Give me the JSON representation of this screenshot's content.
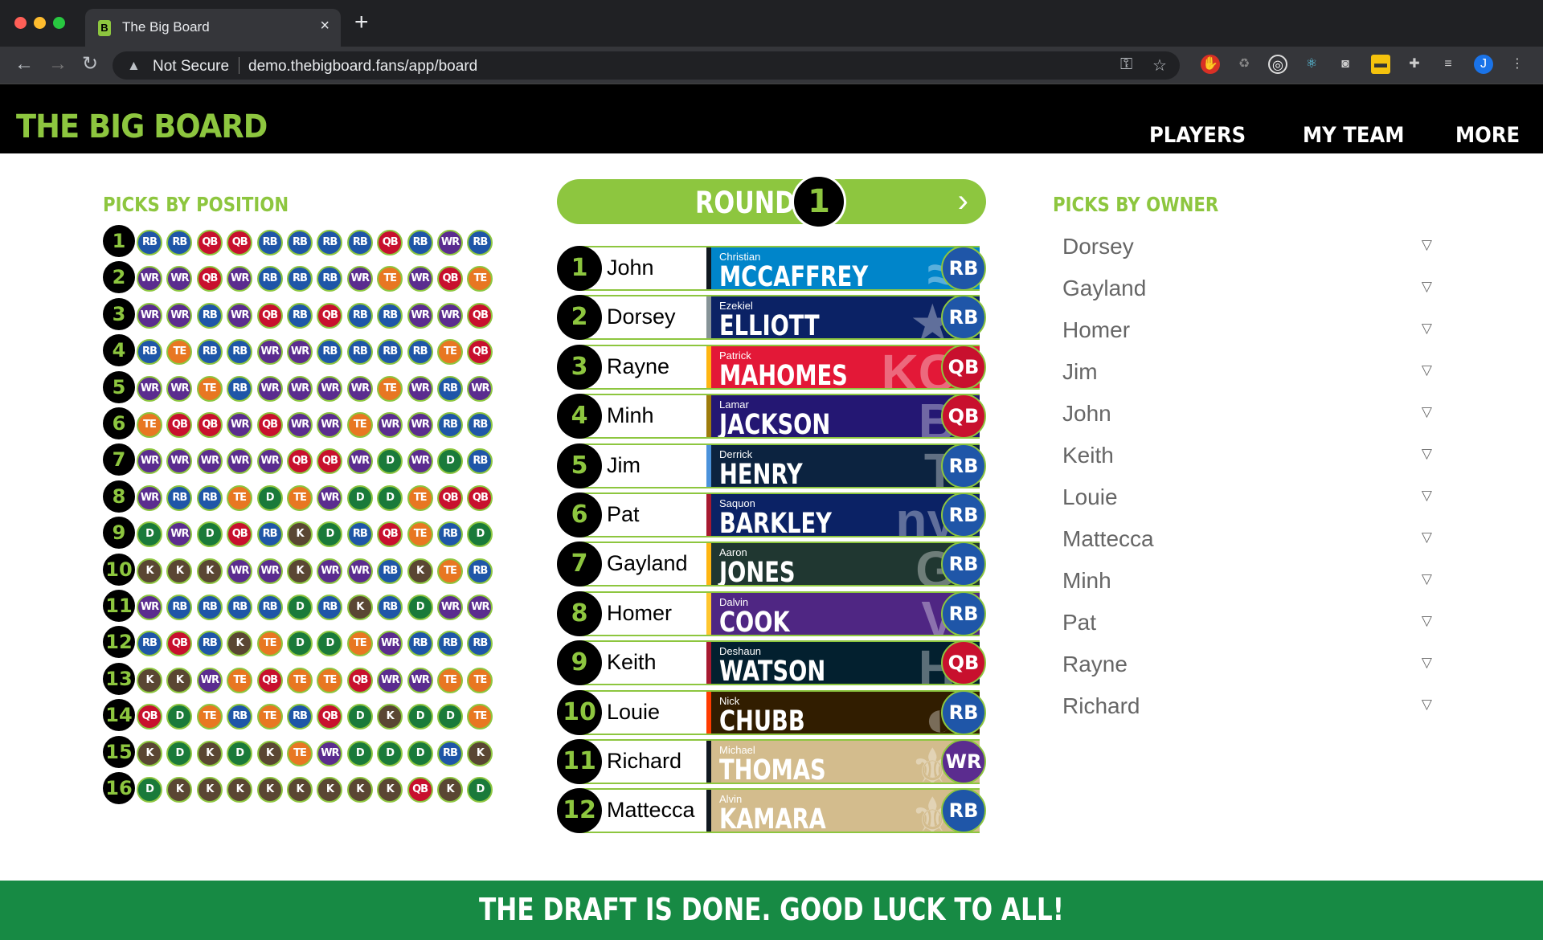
{
  "browser": {
    "tab_title": "The Big Board",
    "tab_favicon": "B",
    "close": "×",
    "new_tab": "+",
    "not_secure": "Not Secure",
    "url": "demo.thebigboard.fans/app/board",
    "profile_initial": "J"
  },
  "header": {
    "logo": "THE BIG BOARD",
    "nav": [
      "PLAYERS",
      "MY TEAM",
      "MORE"
    ]
  },
  "picks_by_position": {
    "title": "PICKS BY POSITION",
    "rows": [
      {
        "num": "1",
        "picks": [
          "RB",
          "RB",
          "QB",
          "QB",
          "RB",
          "RB",
          "RB",
          "RB",
          "QB",
          "RB",
          "WR",
          "RB"
        ]
      },
      {
        "num": "2",
        "picks": [
          "WR",
          "WR",
          "QB",
          "WR",
          "RB",
          "RB",
          "RB",
          "WR",
          "TE",
          "WR",
          "QB",
          "TE"
        ]
      },
      {
        "num": "3",
        "picks": [
          "WR",
          "WR",
          "RB",
          "WR",
          "QB",
          "RB",
          "QB",
          "RB",
          "RB",
          "WR",
          "WR",
          "QB"
        ]
      },
      {
        "num": "4",
        "picks": [
          "RB",
          "TE",
          "RB",
          "RB",
          "WR",
          "WR",
          "RB",
          "RB",
          "RB",
          "RB",
          "TE",
          "QB"
        ]
      },
      {
        "num": "5",
        "picks": [
          "WR",
          "WR",
          "TE",
          "RB",
          "WR",
          "WR",
          "WR",
          "WR",
          "TE",
          "WR",
          "RB",
          "WR"
        ]
      },
      {
        "num": "6",
        "picks": [
          "TE",
          "QB",
          "QB",
          "WR",
          "QB",
          "WR",
          "WR",
          "TE",
          "WR",
          "WR",
          "RB",
          "RB"
        ]
      },
      {
        "num": "7",
        "picks": [
          "WR",
          "WR",
          "WR",
          "WR",
          "WR",
          "QB",
          "QB",
          "WR",
          "D",
          "WR",
          "D",
          "RB"
        ]
      },
      {
        "num": "8",
        "picks": [
          "WR",
          "RB",
          "RB",
          "TE",
          "D",
          "TE",
          "WR",
          "D",
          "D",
          "TE",
          "QB",
          "QB"
        ]
      },
      {
        "num": "9",
        "picks": [
          "D",
          "WR",
          "D",
          "QB",
          "RB",
          "K",
          "D",
          "RB",
          "QB",
          "TE",
          "RB",
          "D"
        ]
      },
      {
        "num": "10",
        "picks": [
          "K",
          "K",
          "K",
          "WR",
          "WR",
          "K",
          "WR",
          "WR",
          "RB",
          "K",
          "TE",
          "RB"
        ]
      },
      {
        "num": "11",
        "picks": [
          "WR",
          "RB",
          "RB",
          "RB",
          "RB",
          "D",
          "RB",
          "K",
          "RB",
          "D",
          "WR",
          "WR"
        ]
      },
      {
        "num": "12",
        "picks": [
          "RB",
          "QB",
          "RB",
          "K",
          "TE",
          "D",
          "D",
          "TE",
          "WR",
          "RB",
          "RB",
          "RB"
        ]
      },
      {
        "num": "13",
        "picks": [
          "K",
          "K",
          "WR",
          "TE",
          "QB",
          "TE",
          "TE",
          "QB",
          "WR",
          "WR",
          "TE",
          "TE"
        ]
      },
      {
        "num": "14",
        "picks": [
          "QB",
          "D",
          "TE",
          "RB",
          "TE",
          "RB",
          "QB",
          "D",
          "K",
          "D",
          "D",
          "TE"
        ]
      },
      {
        "num": "15",
        "picks": [
          "K",
          "D",
          "K",
          "D",
          "K",
          "TE",
          "WR",
          "D",
          "D",
          "D",
          "RB",
          "K"
        ]
      },
      {
        "num": "16",
        "picks": [
          "D",
          "K",
          "K",
          "K",
          "K",
          "K",
          "K",
          "K",
          "K",
          "QB",
          "K",
          "D"
        ]
      }
    ]
  },
  "position_colors": {
    "RB": "#1f56a8",
    "QB": "#c8102e",
    "WR": "#5b2c8f",
    "TE": "#e87722",
    "D": "#1a7a3a",
    "K": "#5a4633"
  },
  "round": {
    "label": "ROUND",
    "number": "1",
    "next_icon": "chevron-right"
  },
  "draft": [
    {
      "pick": "1",
      "owner": "John",
      "first": "Christian",
      "last": "MCCAFFREY",
      "pos": "RB",
      "team_bg": "#0085ca",
      "stripe": "#101820",
      "logo": "≈"
    },
    {
      "pick": "2",
      "owner": "Dorsey",
      "first": "Ezekiel",
      "last": "ELLIOTT",
      "pos": "RB",
      "team_bg": "#0b2265",
      "stripe": "#869397",
      "logo": "★"
    },
    {
      "pick": "3",
      "owner": "Rayne",
      "first": "Patrick",
      "last": "MAHOMES",
      "pos": "QB",
      "team_bg": "#e31837",
      "stripe": "#ffb612",
      "logo": "KC"
    },
    {
      "pick": "4",
      "owner": "Minh",
      "first": "Lamar",
      "last": "JACKSON",
      "pos": "QB",
      "team_bg": "#241773",
      "stripe": "#9e7c0c",
      "logo": "B"
    },
    {
      "pick": "5",
      "owner": "Jim",
      "first": "Derrick",
      "last": "HENRY",
      "pos": "RB",
      "team_bg": "#0c2340",
      "stripe": "#4b92db",
      "logo": "T"
    },
    {
      "pick": "6",
      "owner": "Pat",
      "first": "Saquon",
      "last": "BARKLEY",
      "pos": "RB",
      "team_bg": "#0b2265",
      "stripe": "#a71930",
      "logo": "ny"
    },
    {
      "pick": "7",
      "owner": "Gayland",
      "first": "Aaron",
      "last": "JONES",
      "pos": "RB",
      "team_bg": "#203731",
      "stripe": "#ffb612",
      "logo": "G"
    },
    {
      "pick": "8",
      "owner": "Homer",
      "first": "Dalvin",
      "last": "COOK",
      "pos": "RB",
      "team_bg": "#4f2683",
      "stripe": "#ffc62f",
      "logo": "V"
    },
    {
      "pick": "9",
      "owner": "Keith",
      "first": "Deshaun",
      "last": "WATSON",
      "pos": "QB",
      "team_bg": "#03202f",
      "stripe": "#a71930",
      "logo": "H"
    },
    {
      "pick": "10",
      "owner": "Louie",
      "first": "Nick",
      "last": "CHUBB",
      "pos": "RB",
      "team_bg": "#311d00",
      "stripe": "#ff3c00",
      "logo": "◐"
    },
    {
      "pick": "11",
      "owner": "Richard",
      "first": "Michael",
      "last": "THOMAS",
      "pos": "WR",
      "team_bg": "#d3bc8d",
      "stripe": "#101820",
      "logo": "⚜"
    },
    {
      "pick": "12",
      "owner": "Mattecca",
      "first": "Alvin",
      "last": "KAMARA",
      "pos": "RB",
      "team_bg": "#d3bc8d",
      "stripe": "#101820",
      "logo": "⚜"
    }
  ],
  "picks_by_owner": {
    "title": "PICKS BY OWNER",
    "owners": [
      "Dorsey",
      "Gayland",
      "Homer",
      "Jim",
      "John",
      "Keith",
      "Louie",
      "Mattecca",
      "Minh",
      "Pat",
      "Rayne",
      "Richard"
    ],
    "caret": "▽"
  },
  "footer": {
    "text": "THE DRAFT IS DONE. GOOD LUCK TO ALL!"
  }
}
